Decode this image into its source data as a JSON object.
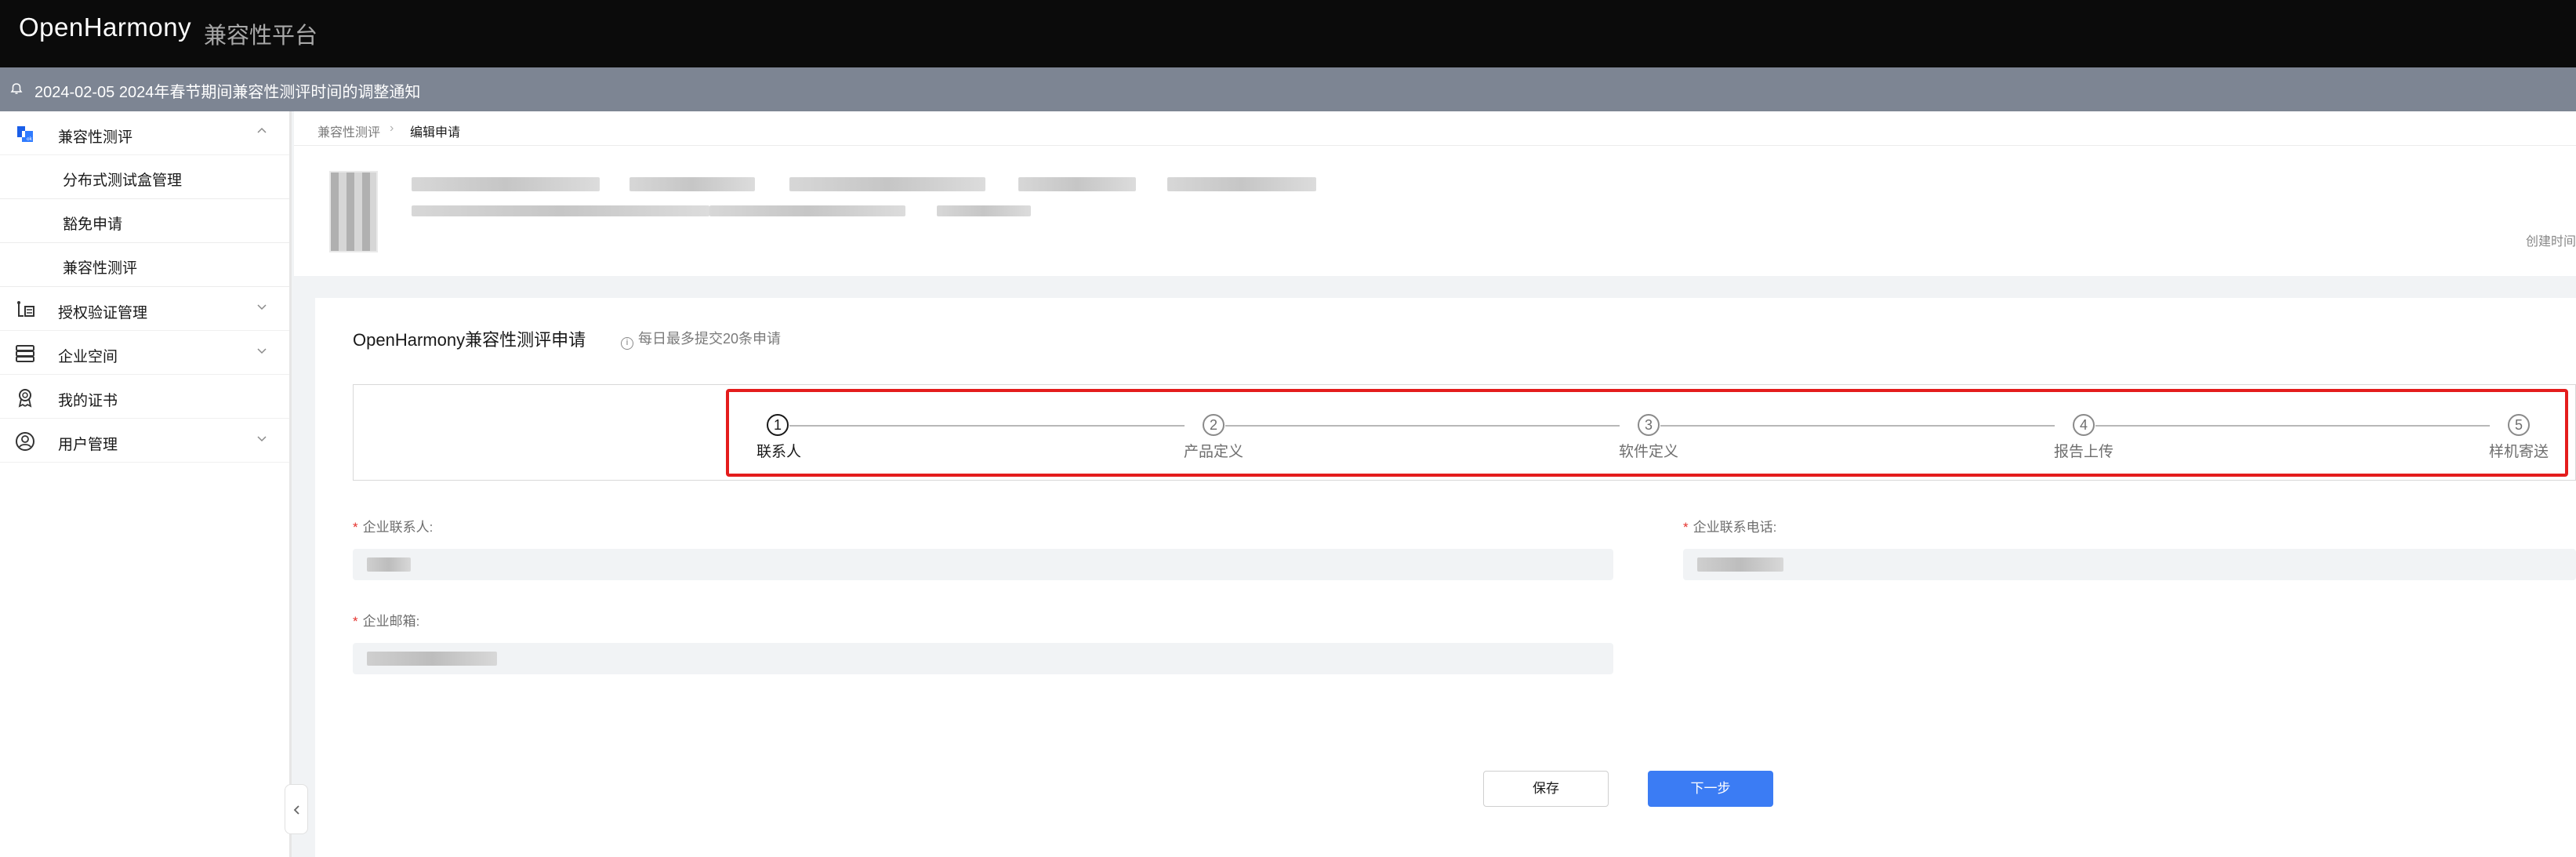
{
  "header": {
    "brand": "OpenHarmony",
    "subtitle": "兼容性平台"
  },
  "notice": {
    "text": "2024-02-05 2024年春节期间兼容性测评时间的调整通知"
  },
  "sidebar": {
    "items": [
      {
        "label": "兼容性测评",
        "icon": "compat-logo-icon",
        "expanded": true
      },
      {
        "label": "授权验证管理",
        "icon": "auth-verify-icon",
        "expanded": false
      },
      {
        "label": "企业空间",
        "icon": "database-icon",
        "expanded": false
      },
      {
        "label": "我的证书",
        "icon": "certificate-icon"
      },
      {
        "label": "用户管理",
        "icon": "user-circle-icon",
        "expanded": false
      }
    ],
    "subitems": [
      {
        "label": "分布式测试盒管理"
      },
      {
        "label": "豁免申请"
      },
      {
        "label": "兼容性测评"
      }
    ]
  },
  "breadcrumb": {
    "items": [
      "兼容性测评",
      "编辑申请"
    ]
  },
  "info": {
    "created_label": "创建时间"
  },
  "form": {
    "title": "OpenHarmony兼容性测评申请",
    "tip": "每日最多提交20条申请",
    "steps": [
      {
        "num": "1",
        "label": "联系人",
        "active": true
      },
      {
        "num": "2",
        "label": "产品定义",
        "active": false
      },
      {
        "num": "3",
        "label": "软件定义",
        "active": false
      },
      {
        "num": "4",
        "label": "报告上传",
        "active": false
      },
      {
        "num": "5",
        "label": "样机寄送",
        "active": false
      }
    ],
    "fields": {
      "contact_label": "企业联系人:",
      "phone_label": "企业联系电话:",
      "email_label": "企业邮箱:"
    },
    "buttons": {
      "save": "保存",
      "next": "下一步"
    }
  },
  "colors": {
    "accent": "#3b7cf4",
    "highlight": "#e41c1c",
    "topbar": "#0b0b0b",
    "notice": "#7d8593"
  }
}
